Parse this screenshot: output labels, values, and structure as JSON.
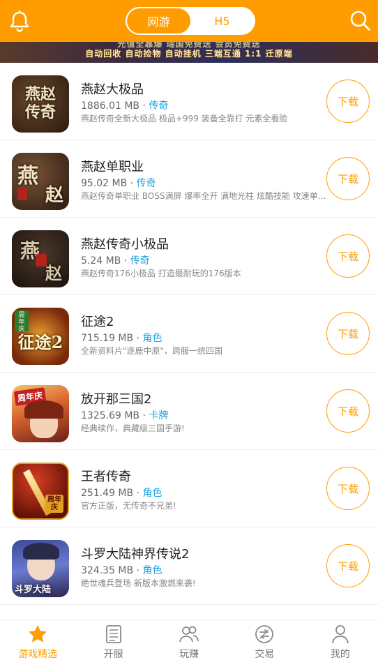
{
  "header": {
    "tabs": [
      {
        "label": "网游",
        "active": true
      },
      {
        "label": "H5",
        "active": false
      }
    ]
  },
  "banner": {
    "line1": "光值全靠爆  瑞国免费送  会员免费送",
    "line2": "自动回收  自动捡物  自动挂机  三端互通  1:1 迁原端"
  },
  "games": [
    {
      "title": "燕赵大极品",
      "size": "1886.01 MB",
      "tag": "传奇",
      "desc": "燕赵传奇全新大极品 极品+999 装备全靠打 元素全看脸",
      "download": "下载",
      "icon_text": "燕赵传奇",
      "icon_bg": "#3a2a1c"
    },
    {
      "title": "燕赵单职业",
      "size": "95.02 MB",
      "tag": "传奇",
      "desc": "燕赵传奇单职业 BOSS满屏 爆率全开 满地光柱 炫酷技能 攻速单职业",
      "download": "下载",
      "icon_text": "燕 赵",
      "icon_bg": "#4a2f22"
    },
    {
      "title": "燕赵传奇小极品",
      "size": "5.24 MB",
      "tag": "传奇",
      "desc": "燕赵传奇176小极品 打造最耐玩的176版本",
      "download": "下载",
      "icon_text": "燕 赵",
      "icon_bg": "#2b1d17"
    },
    {
      "title": "征途2",
      "size": "715.19 MB",
      "tag": "角色",
      "desc": "全新资料片\"逐鹿中原\"，跨服一统四国",
      "download": "下载",
      "icon_text": "征途2",
      "icon_bg": "#8a3b12"
    },
    {
      "title": "放开那三国2",
      "size": "1325.69 MB",
      "tag": "卡牌",
      "desc": "经典续作，典藏级三国手游!",
      "download": "下载",
      "icon_text": "周年庆",
      "icon_bg": "#c8552a"
    },
    {
      "title": "王者传奇",
      "size": "251.49 MB",
      "tag": "角色",
      "desc": "官方正版，无传奇不兄弟!",
      "download": "下载",
      "icon_text": "周年庆",
      "icon_bg": "#8d1c10"
    },
    {
      "title": "斗罗大陆神界传说2",
      "size": "324.35 MB",
      "tag": "角色",
      "desc": "绝世魂兵登场 新版本激燃来袭!",
      "download": "下载",
      "icon_text": "斗罗大陆",
      "icon_bg": "#3a3f7a"
    }
  ],
  "bottom_nav": [
    {
      "label": "游戏精选",
      "icon": "star-icon",
      "active": true
    },
    {
      "label": "开服",
      "icon": "document-icon",
      "active": false
    },
    {
      "label": "玩赚",
      "icon": "users-icon",
      "active": false
    },
    {
      "label": "交易",
      "icon": "exchange-icon",
      "active": false
    },
    {
      "label": "我的",
      "icon": "person-icon",
      "active": false
    }
  ],
  "colors": {
    "accent": "#ff9c00",
    "tag": "#1aa1e6"
  }
}
